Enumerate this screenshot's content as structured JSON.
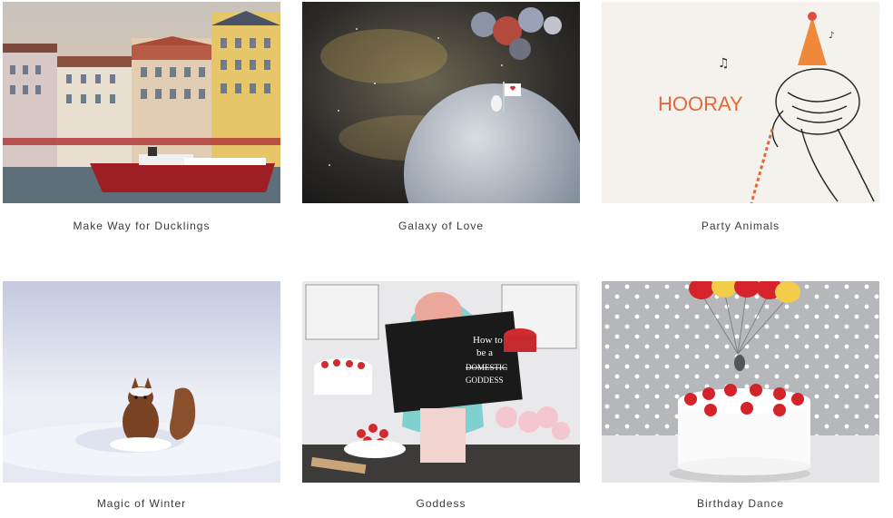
{
  "gallery": {
    "items": [
      {
        "title": "Make Way for Ducklings"
      },
      {
        "title": "Galaxy of Love"
      },
      {
        "title": "Party Animals",
        "art_text": "HOORAY"
      },
      {
        "title": "Magic of Winter"
      },
      {
        "title": "Goddess",
        "art_text": [
          "How to",
          "be a",
          "DOMESTIC",
          "GODDESS"
        ]
      },
      {
        "title": "Birthday Dance"
      }
    ]
  }
}
